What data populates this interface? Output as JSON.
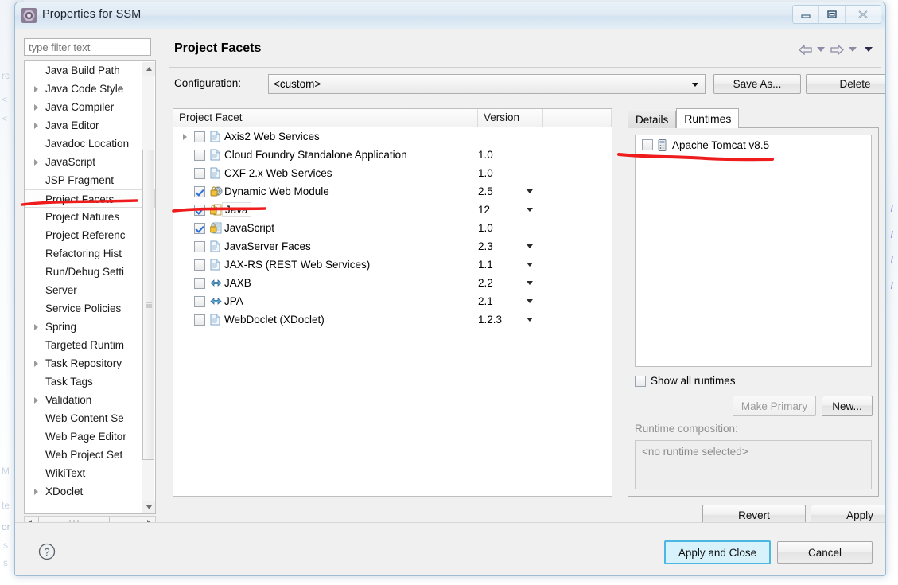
{
  "window": {
    "title": "Properties for SSM",
    "icon": "eclipse-properties-icon",
    "controls": {
      "minimize": "minimize-icon",
      "restore": "restore-icon",
      "close": "close-icon"
    }
  },
  "sidebar": {
    "filter_placeholder": "type filter text",
    "filter_value": "",
    "items": [
      {
        "label": "Java Build Path",
        "expandable": false,
        "selected": false
      },
      {
        "label": "Java Code Style",
        "expandable": true,
        "selected": false
      },
      {
        "label": "Java Compiler",
        "expandable": true,
        "selected": false
      },
      {
        "label": "Java Editor",
        "expandable": true,
        "selected": false
      },
      {
        "label": "Javadoc Location",
        "expandable": false,
        "selected": false
      },
      {
        "label": "JavaScript",
        "expandable": true,
        "selected": false
      },
      {
        "label": "JSP Fragment",
        "expandable": false,
        "selected": false
      },
      {
        "label": "Project Facets",
        "expandable": false,
        "selected": true
      },
      {
        "label": "Project Natures",
        "expandable": false,
        "selected": false
      },
      {
        "label": "Project Referenc",
        "expandable": false,
        "selected": false
      },
      {
        "label": "Refactoring Hist",
        "expandable": false,
        "selected": false
      },
      {
        "label": "Run/Debug Setti",
        "expandable": false,
        "selected": false
      },
      {
        "label": "Server",
        "expandable": false,
        "selected": false
      },
      {
        "label": "Service Policies",
        "expandable": false,
        "selected": false
      },
      {
        "label": "Spring",
        "expandable": true,
        "selected": false
      },
      {
        "label": "Targeted Runtim",
        "expandable": false,
        "selected": false
      },
      {
        "label": "Task Repository",
        "expandable": true,
        "selected": false
      },
      {
        "label": "Task Tags",
        "expandable": false,
        "selected": false
      },
      {
        "label": "Validation",
        "expandable": true,
        "selected": false
      },
      {
        "label": "Web Content Se",
        "expandable": false,
        "selected": false
      },
      {
        "label": "Web Page Editor",
        "expandable": false,
        "selected": false
      },
      {
        "label": "Web Project Set",
        "expandable": false,
        "selected": false
      },
      {
        "label": "WikiText",
        "expandable": false,
        "selected": false
      },
      {
        "label": "XDoclet",
        "expandable": true,
        "selected": false
      }
    ]
  },
  "page": {
    "title": "Project Facets",
    "nav": {
      "back": "back-arrow-icon",
      "back_menu": "chevron-down-icon",
      "forward": "forward-arrow-icon",
      "forward_menu": "chevron-down-icon",
      "view_menu": "chevron-down-icon"
    }
  },
  "configuration": {
    "label": "Configuration:",
    "value": "<custom>",
    "save_as_label": "Save As...",
    "delete_label": "Delete"
  },
  "facets_table": {
    "columns": [
      "Project Facet",
      "Version",
      ""
    ],
    "rows": [
      {
        "name": "Axis2 Web Services",
        "version": "",
        "checked": false,
        "expandable": true,
        "icon": "document-icon",
        "has_version_dropdown": false
      },
      {
        "name": "Cloud Foundry Standalone Application",
        "version": "1.0",
        "checked": false,
        "expandable": false,
        "icon": "document-icon",
        "has_version_dropdown": false
      },
      {
        "name": "CXF 2.x Web Services",
        "version": "1.0",
        "checked": false,
        "expandable": false,
        "icon": "document-icon",
        "has_version_dropdown": false
      },
      {
        "name": "Dynamic Web Module",
        "version": "2.5",
        "checked": true,
        "expandable": false,
        "icon": "web-module-lock-icon",
        "has_version_dropdown": true
      },
      {
        "name": "Java",
        "version": "12",
        "checked": true,
        "expandable": false,
        "icon": "java-lock-icon",
        "has_version_dropdown": true,
        "selected": true
      },
      {
        "name": "JavaScript",
        "version": "1.0",
        "checked": true,
        "expandable": false,
        "icon": "javascript-lock-icon",
        "has_version_dropdown": false
      },
      {
        "name": "JavaServer Faces",
        "version": "2.3",
        "checked": false,
        "expandable": false,
        "icon": "document-icon",
        "has_version_dropdown": true
      },
      {
        "name": "JAX-RS (REST Web Services)",
        "version": "1.1",
        "checked": false,
        "expandable": false,
        "icon": "document-icon",
        "has_version_dropdown": true
      },
      {
        "name": "JAXB",
        "version": "2.2",
        "checked": false,
        "expandable": false,
        "icon": "arrows-icon",
        "has_version_dropdown": true
      },
      {
        "name": "JPA",
        "version": "2.1",
        "checked": false,
        "expandable": false,
        "icon": "arrows-icon",
        "has_version_dropdown": true
      },
      {
        "name": "WebDoclet (XDoclet)",
        "version": "1.2.3",
        "checked": false,
        "expandable": false,
        "icon": "document-icon",
        "has_version_dropdown": true
      }
    ]
  },
  "side_tabs": {
    "tabs": [
      {
        "label": "Details",
        "active": false
      },
      {
        "label": "Runtimes",
        "active": true
      }
    ],
    "runtimes": [
      {
        "label": "Apache Tomcat v8.5",
        "checked": false,
        "icon": "server-icon"
      }
    ],
    "show_all_runtimes": {
      "label": "Show all runtimes",
      "checked": false
    },
    "make_primary_label": "Make Primary",
    "make_primary_enabled": false,
    "new_label": "New...",
    "runtime_composition_label": "Runtime composition:",
    "runtime_composition_value": "<no runtime selected>"
  },
  "actions": {
    "revert": "Revert",
    "apply": "Apply",
    "apply_and_close": "Apply and Close",
    "cancel": "Cancel",
    "help": "help-icon"
  },
  "annotations": {
    "color": "#ee1c1c",
    "marks": [
      {
        "target": "sidebar-item-project-facets"
      },
      {
        "target": "facet-row-java"
      },
      {
        "target": "runtime-apache-tomcat"
      }
    ]
  },
  "colors": {
    "title_bar": "#dfeaf4",
    "dialog_bg": "#f0f0f0",
    "default_button_border": "#4ab8e0",
    "default_button_bg": "#d7f2fb",
    "checkbox_check": "#2c6fd6",
    "annotation_red": "#ee1c1c"
  },
  "backdrop_ghosts": [
    "rc",
    "<",
    "<",
    "M",
    "te",
    "or",
    "s",
    "s"
  ]
}
